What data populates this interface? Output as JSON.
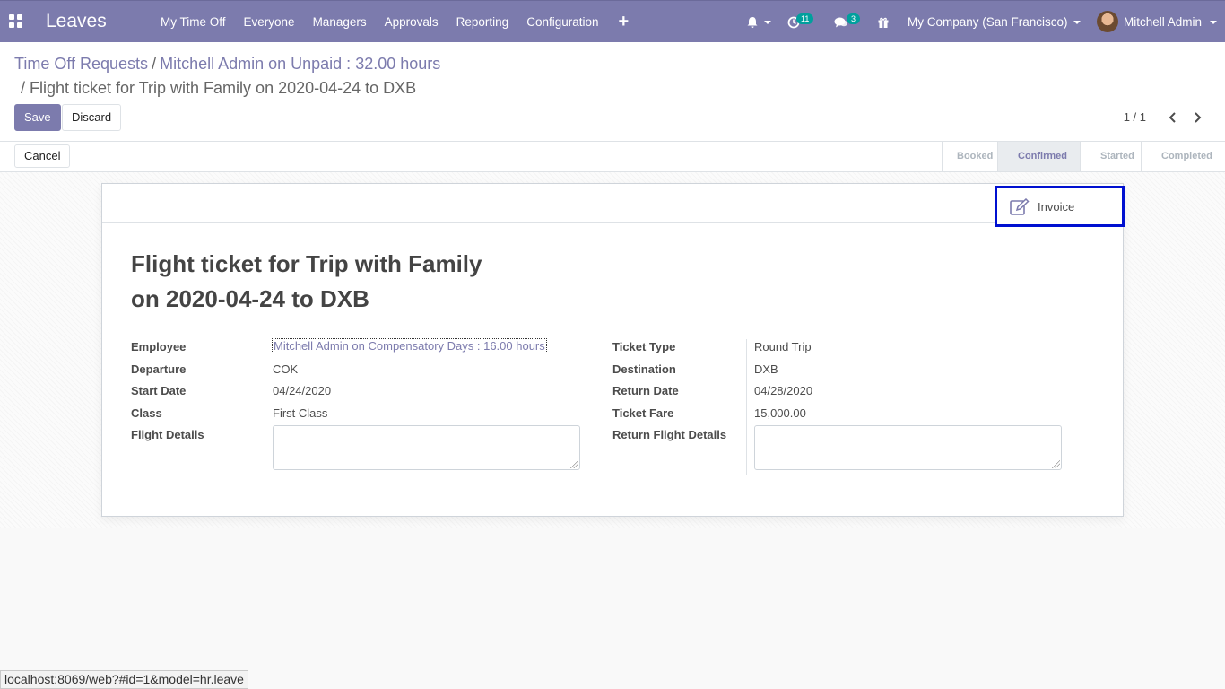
{
  "navbar": {
    "brand": "Leaves",
    "menu": [
      "My Time Off",
      "Everyone",
      "Managers",
      "Approvals",
      "Reporting",
      "Configuration"
    ],
    "plus": "+",
    "activity_count": "11",
    "messages_count": "3",
    "company": "My Company (San Francisco)",
    "user": "Mitchell Admin",
    "accent_color": "#7c7bad"
  },
  "breadcrumb": {
    "root": "Time Off Requests",
    "sep": "/",
    "parent": "Mitchell Admin on Unpaid : 32.00 hours",
    "current": "/ Flight ticket for Trip with Family on 2020-04-24 to DXB"
  },
  "actions": {
    "save": "Save",
    "discard": "Discard",
    "cancel": "Cancel"
  },
  "pager": {
    "value": "1 / 1"
  },
  "status": {
    "steps": [
      "Booked",
      "Confirmed",
      "Started",
      "Completed"
    ],
    "active": "Confirmed"
  },
  "smart_button": {
    "label": "Invoice",
    "icon": "edit-icon"
  },
  "record": {
    "title_line1": "Flight ticket for Trip with Family",
    "title_line2": "on 2020-04-24 to DXB",
    "left": {
      "employee_label": "Employee",
      "employee_value": "Mitchell Admin on Compensatory Days : 16.00 hours",
      "departure_label": "Departure",
      "departure_value": "COK",
      "start_date_label": "Start Date",
      "start_date_value": "04/24/2020",
      "class_label": "Class",
      "class_value": "First Class",
      "flight_details_label": "Flight Details",
      "flight_details_value": ""
    },
    "right": {
      "ticket_type_label": "Ticket Type",
      "ticket_type_value": "Round Trip",
      "destination_label": "Destination",
      "destination_value": "DXB",
      "return_date_label": "Return Date",
      "return_date_value": "04/28/2020",
      "ticket_fare_label": "Ticket Fare",
      "ticket_fare_value": "15,000.00",
      "return_flight_label": "Return Flight Details",
      "return_flight_value": ""
    }
  },
  "status_url": "localhost:8069/web?#id=1&model=hr.leave"
}
